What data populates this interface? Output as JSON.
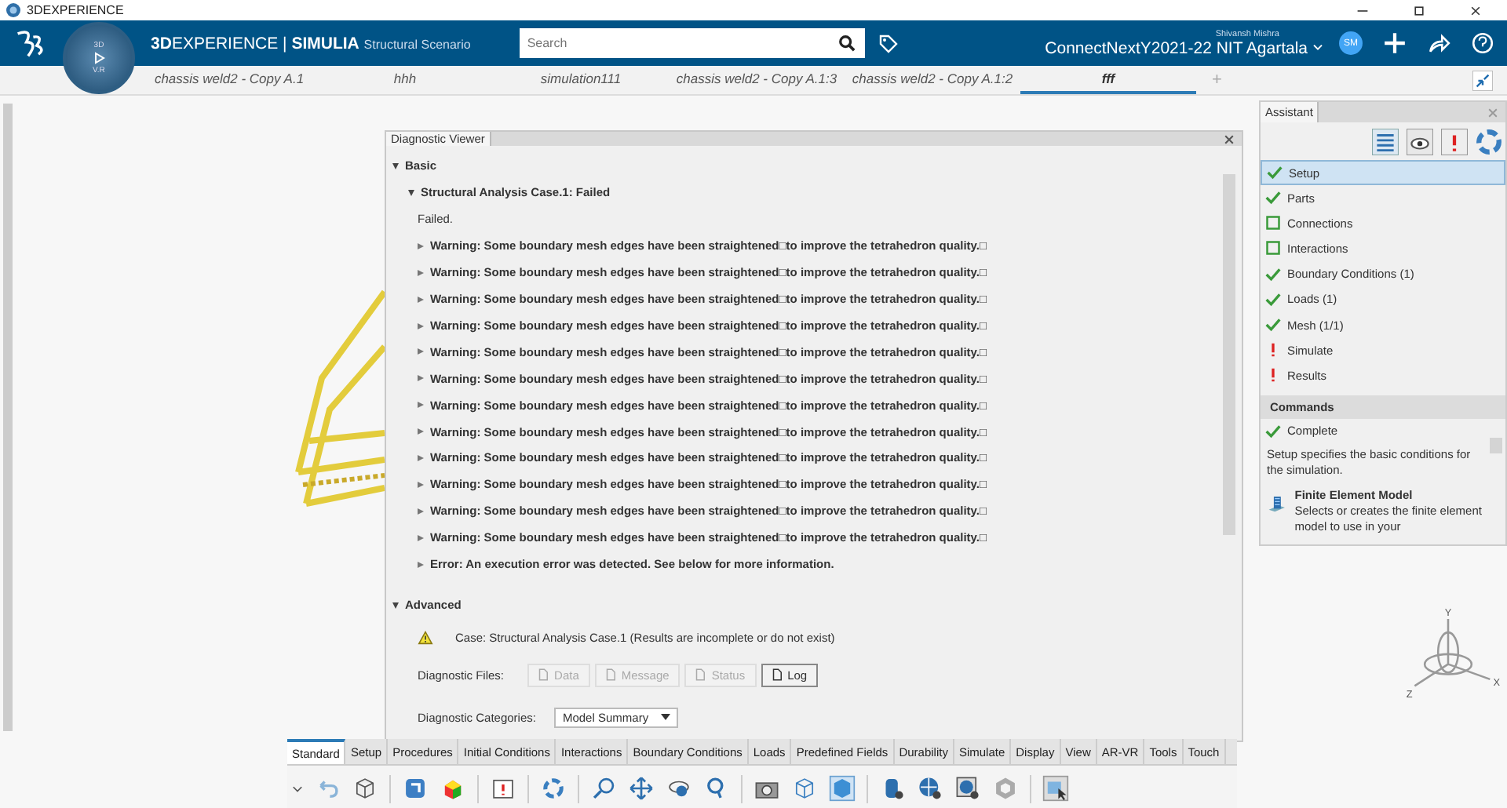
{
  "window": {
    "title": "3DEXPERIENCE"
  },
  "header": {
    "brand_bold": "3D",
    "brand": "EXPERIENCE",
    "separator": "|",
    "app": "SIMULIA",
    "app_sub": "Structural Scenario",
    "compass_top": "3D",
    "compass_bottom": "V.R",
    "search": {
      "placeholder": "Search"
    },
    "user": "Shivansh Mishra",
    "tenant": "ConnectNextY2021-22 NIT Agartala",
    "avatar": "SM"
  },
  "tabs": [
    {
      "label": "chassis weld2 - Copy A.1",
      "selected": false
    },
    {
      "label": "hhh",
      "selected": false
    },
    {
      "label": "simulation111",
      "selected": false
    },
    {
      "label": "chassis weld2 - Copy A.1:3",
      "selected": false
    },
    {
      "label": "chassis weld2 - Copy A.1:2",
      "selected": false
    },
    {
      "label": "fff",
      "selected": true
    }
  ],
  "new_tab": "+",
  "diagnostic_viewer": {
    "title": "Diagnostic Viewer",
    "basic": {
      "label": "Basic",
      "expanded": true
    },
    "case": {
      "label": "Structural Analysis Case.1: Failed",
      "expanded": true
    },
    "status": "Failed.",
    "messages": [
      {
        "text": "Warning: Some boundary mesh edges have been straightened□to improve the tetrahedron quality.□"
      },
      {
        "text": "Warning: Some boundary mesh edges have been straightened□to improve the tetrahedron quality.□"
      },
      {
        "text": "Warning: Some boundary mesh edges have been straightened□to improve the tetrahedron quality.□"
      },
      {
        "text": "Warning: Some boundary mesh edges have been straightened□to improve the tetrahedron quality.□"
      },
      {
        "text": "Warning: Some boundary mesh edges have been straightened□to improve the tetrahedron quality.□"
      },
      {
        "text": "Warning: Some boundary mesh edges have been straightened□to improve the tetrahedron quality.□"
      },
      {
        "text": "Warning: Some boundary mesh edges have been straightened□to improve the tetrahedron quality.□"
      },
      {
        "text": "Warning: Some boundary mesh edges have been straightened□to improve the tetrahedron quality.□"
      },
      {
        "text": "Warning: Some boundary mesh edges have been straightened□to improve the tetrahedron quality.□"
      },
      {
        "text": "Warning: Some boundary mesh edges have been straightened□to improve the tetrahedron quality.□"
      },
      {
        "text": "Warning: Some boundary mesh edges have been straightened□to improve the tetrahedron quality.□"
      },
      {
        "text": "Warning: Some boundary mesh edges have been straightened□to improve the tetrahedron quality.□"
      },
      {
        "text": "Error: An execution error was detected. See below for more information."
      }
    ],
    "advanced": {
      "label": "Advanced",
      "expanded": true
    },
    "case_note": "Case: Structural Analysis Case.1 (Results are incomplete or do not exist)",
    "files_label": "Diagnostic Files:",
    "files": [
      {
        "label": "Data",
        "disabled": true
      },
      {
        "label": "Message",
        "disabled": true
      },
      {
        "label": "Status",
        "disabled": true
      },
      {
        "label": "Log",
        "disabled": false
      }
    ],
    "categories_label": "Diagnostic Categories:",
    "category": "Model Summary"
  },
  "assistant": {
    "title": "Assistant",
    "steps": [
      {
        "label": "Setup",
        "kind": "done",
        "selected": true
      },
      {
        "label": "Parts",
        "kind": "done",
        "selected": false
      },
      {
        "label": "Connections",
        "kind": "open",
        "selected": false
      },
      {
        "label": "Interactions",
        "kind": "open",
        "selected": false
      },
      {
        "label": "Boundary Conditions (1)",
        "kind": "done",
        "selected": false
      },
      {
        "label": "Loads (1)",
        "kind": "done",
        "selected": false
      },
      {
        "label": "Mesh (1/1)",
        "kind": "done",
        "selected": false
      },
      {
        "label": "Simulate",
        "kind": "alert",
        "selected": false
      },
      {
        "label": "Results",
        "kind": "alert",
        "selected": false
      }
    ],
    "commands_title": "Commands",
    "complete": "Complete",
    "description": "Setup specifies the basic conditions for the simulation.",
    "command": {
      "title": "Finite Element Model",
      "text": "Selects or creates the finite element model to use in your"
    }
  },
  "compass": {
    "x": "X",
    "y": "Y",
    "z": "Z"
  },
  "action_tabs": [
    {
      "label": "Standard",
      "selected": true
    },
    {
      "label": "Setup",
      "selected": false
    },
    {
      "label": "Procedures",
      "selected": false
    },
    {
      "label": "Initial Conditions",
      "selected": false
    },
    {
      "label": "Interactions",
      "selected": false
    },
    {
      "label": "Boundary Conditions",
      "selected": false
    },
    {
      "label": "Loads",
      "selected": false
    },
    {
      "label": "Predefined Fields",
      "selected": false
    },
    {
      "label": "Durability",
      "selected": false
    },
    {
      "label": "Simulate",
      "selected": false
    },
    {
      "label": "Display",
      "selected": false
    },
    {
      "label": "View",
      "selected": false
    },
    {
      "label": "AR-VR",
      "selected": false
    },
    {
      "label": "Tools",
      "selected": false
    },
    {
      "label": "Touch",
      "selected": false
    }
  ]
}
